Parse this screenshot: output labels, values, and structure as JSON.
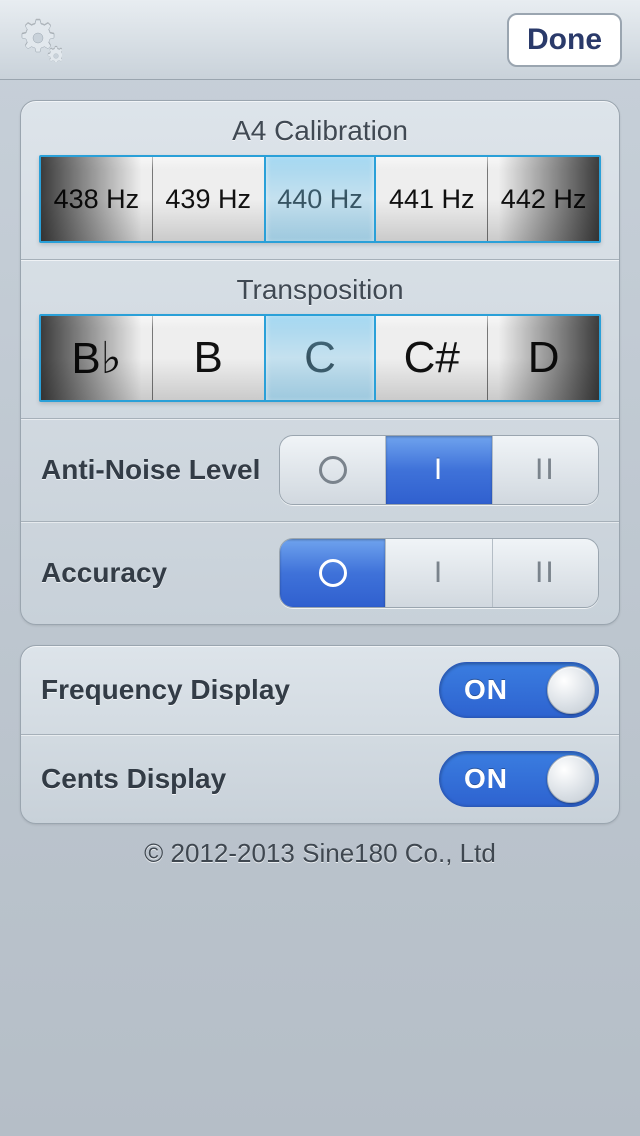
{
  "header": {
    "done_label": "Done"
  },
  "panel1": {
    "calibration": {
      "title": "A4 Calibration",
      "options": [
        "438 Hz",
        "439 Hz",
        "440 Hz",
        "441 Hz",
        "442 Hz"
      ],
      "selected_index": 2
    },
    "transposition": {
      "title": "Transposition",
      "options": [
        "B♭",
        "B",
        "C",
        "C#",
        "D"
      ],
      "selected_index": 2
    },
    "anti_noise": {
      "label": "Anti-Noise Level",
      "options": [
        "O",
        "I",
        "II"
      ],
      "selected_index": 1
    },
    "accuracy": {
      "label": "Accuracy",
      "options": [
        "O",
        "I",
        "II"
      ],
      "selected_index": 0
    }
  },
  "panel2": {
    "frequency": {
      "label": "Frequency Display",
      "value": true,
      "on_text": "ON"
    },
    "cents": {
      "label": "Cents Display",
      "value": true,
      "on_text": "ON"
    }
  },
  "footer": {
    "copyright": "© 2012-2013 Sine180 Co., Ltd"
  }
}
